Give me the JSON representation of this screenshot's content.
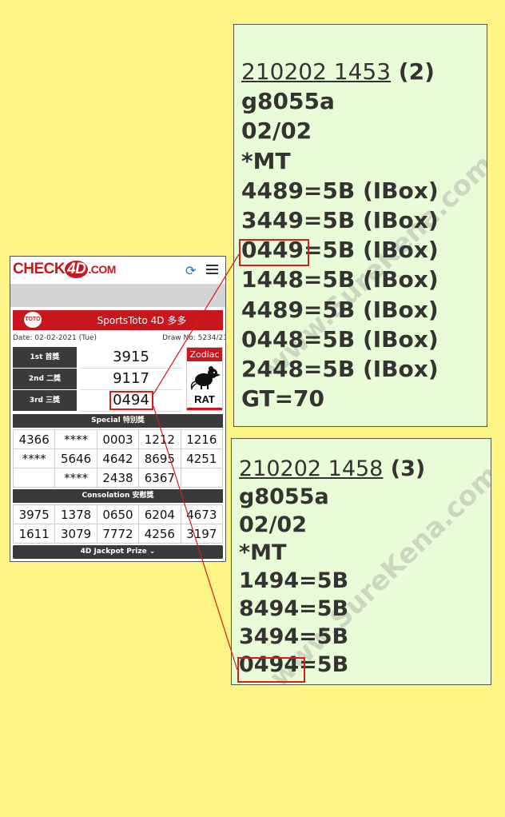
{
  "site": {
    "logo_prefix": "CHECK",
    "logo_four": "4D",
    "logo_suffix": ".COM"
  },
  "icons": {
    "refresh": "refresh-icon",
    "menu": "hamburger-menu-icon",
    "zodiac": "rat-icon",
    "chevron": "chevron-down-icon"
  },
  "colors": {
    "brand_red": "#c8161d",
    "page_bg": "#fff585",
    "panel_bg": "#e8fcd8",
    "highlight": "#d81b1b"
  },
  "draw": {
    "toto_logo": "TOTO",
    "title": "SportsToto 4D 多多",
    "date": "Date: 02-02-2021 (Tue)",
    "draw_no": "Draw No: 5234/21"
  },
  "prizes": [
    {
      "label": "1st 首獎",
      "value": "3915"
    },
    {
      "label": "2nd 二獎",
      "value": "9117"
    },
    {
      "label": "3rd 三獎",
      "value": "0494"
    }
  ],
  "zodiac": {
    "label": "Zodiac",
    "name": "RAT"
  },
  "special": {
    "title": "Special 特別獎",
    "rows": [
      [
        "4366",
        "****",
        "0003",
        "1212",
        "1216"
      ],
      [
        "****",
        "5646",
        "4642",
        "8695",
        "4251"
      ],
      [
        "",
        "****",
        "2438",
        "6367",
        ""
      ]
    ]
  },
  "consolation": {
    "title": "Consolation 安慰獎",
    "rows": [
      [
        "3975",
        "1378",
        "0650",
        "6204",
        "4673"
      ],
      [
        "1611",
        "3079",
        "7772",
        "4256",
        "3197"
      ]
    ]
  },
  "jackpot": {
    "label": "4D Jackpot Prize"
  },
  "panel_a": {
    "header_id": "210202 1453",
    "header_count": "(2)",
    "lines": [
      "g8055a",
      "02/02",
      "*MT",
      "4489=5B (IBox)",
      "3449=5B (IBox)",
      "=5B (IBox)",
      "1448=5B (IBox)",
      "4489=5B (IBox)",
      "0448=5B (IBox)",
      "2448=5B (IBox)",
      "GT=70"
    ],
    "highlight_number": "0449",
    "watermark": "www.SureKena.com"
  },
  "panel_b": {
    "header_id": "210202 1458",
    "header_count": "(3)",
    "lines": [
      "g8055a",
      "02/02",
      "*MT",
      "1494=5B",
      "8494=5B",
      "3494=5B",
      "=5B"
    ],
    "highlight_number": "0494",
    "watermark": "www.SureKena.com"
  }
}
